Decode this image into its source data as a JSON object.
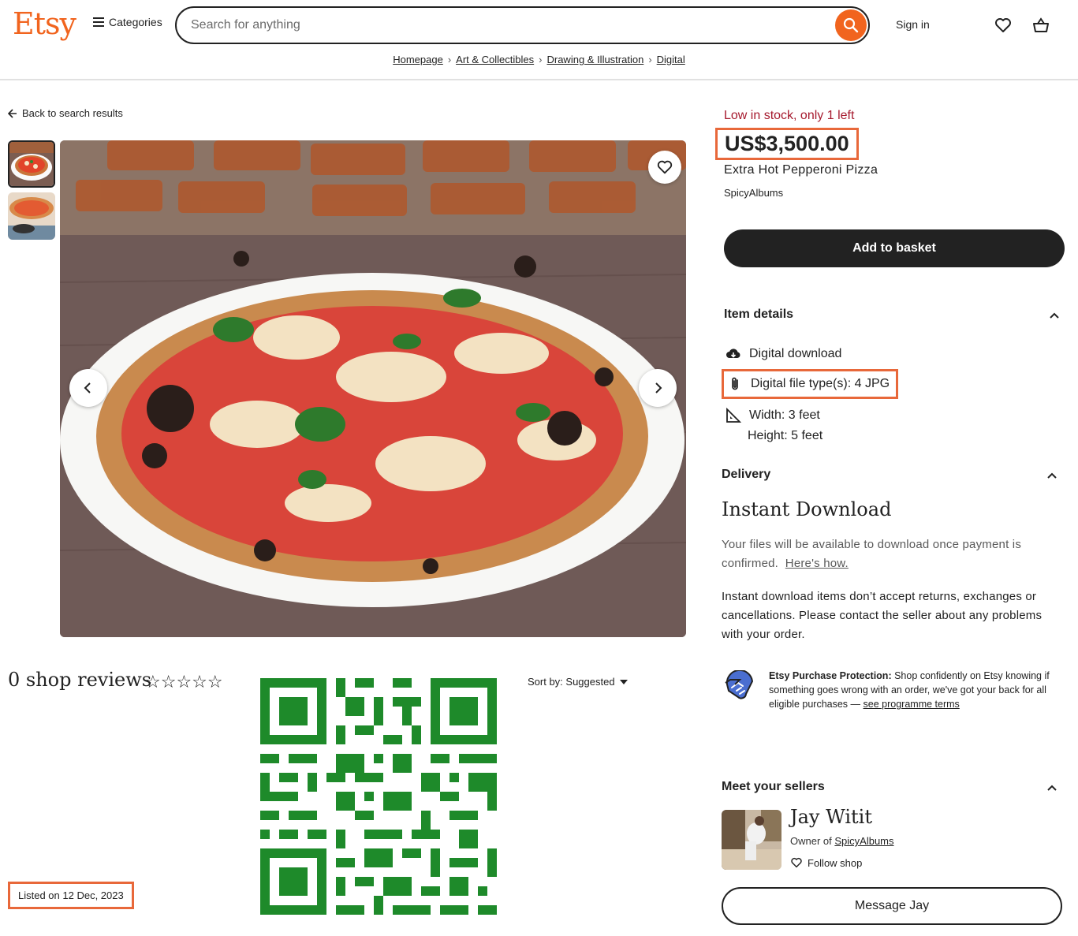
{
  "header": {
    "logo": "Etsy",
    "categories_label": "Categories",
    "search_placeholder": "Search for anything",
    "signin_label": "Sign in"
  },
  "breadcrumb": [
    "Homepage",
    "Art & Collectibles",
    "Drawing & Illustration",
    "Digital"
  ],
  "left": {
    "back_label": "Back to search results",
    "reviews_title": "0 shop reviews",
    "stars": "☆☆☆☆☆",
    "sort_label": "Sort by: Suggested",
    "listed": "Listed on 12 Dec, 2023"
  },
  "product": {
    "stock_note": "Low in stock, only 1 left",
    "price": "US$3,500.00",
    "title": "Extra Hot Pepperoni Pizza",
    "shop_name": "SpicyAlbums",
    "add_to_basket": "Add to basket"
  },
  "item_details": {
    "heading": "Item details",
    "digital_download": "Digital download",
    "file_type": "Digital file type(s): 4 JPG",
    "width": "Width: 3 feet",
    "height": "Height: 5 feet"
  },
  "delivery": {
    "heading": "Delivery",
    "title": "Instant Download",
    "info": "Your files will be available to download once payment is confirmed.",
    "info_link": "Here's how.",
    "returns": "Instant download items don’t accept returns, exchanges or cancellations. Please contact the seller about any problems with your order."
  },
  "protection": {
    "label": "Etsy Purchase Protection:",
    "text": "Shop confidently on Etsy knowing if something goes wrong with an order, we've got your back for all eligible purchases —",
    "link": "see programme terms"
  },
  "sellers": {
    "heading": "Meet your sellers",
    "name": "Jay Witit",
    "owner_prefix": "Owner of",
    "shop_link": "SpicyAlbums",
    "follow_label": "Follow shop",
    "message_label": "Message Jay"
  },
  "colors": {
    "brand": "#f1641e",
    "highlight_border": "#e8683a",
    "stock_warning": "#a61a2e",
    "qr": "#1e8a2a"
  },
  "icons": [
    "hamburger-icon",
    "search-icon",
    "heart-icon",
    "basket-icon",
    "arrow-left-icon",
    "chevron-left-icon",
    "chevron-right-icon",
    "chevron-up-icon",
    "download-icon",
    "paperclip-icon",
    "ruler-icon",
    "handshake-icon"
  ]
}
